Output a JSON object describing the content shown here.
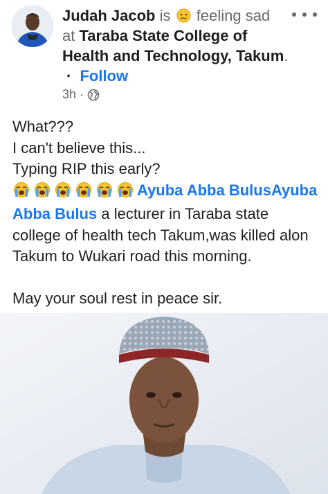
{
  "post": {
    "author": "Judah Jacob",
    "is_text": "is",
    "feeling_emoji": "confused-sad-face-icon",
    "feeling_text": "feeling sad",
    "at_text": "at",
    "location": "Taraba State College of Health and Technology, Takum",
    "location_period": ".",
    "follow_label": "Follow",
    "timestamp": "3h",
    "meta_separator": "·",
    "privacy_icon": "globe-icon",
    "body": {
      "line1": "What???",
      "line2": "I can't believe this...",
      "line3": "Typing RIP this early?",
      "crying_emojis": 6,
      "mention": "Ayuba Abba BulusAyuba Abba Bulus",
      "rest": " a lecturer in Taraba state college of health tech Takum,was killed alon Takum to Wukari road this morning.",
      "closing": "May your soul rest in peace sir."
    },
    "photo": {
      "subject": "man in white traditional cap"
    }
  },
  "colors": {
    "link": "#1877f2",
    "text": "#1c1e21",
    "muted": "#65676b"
  }
}
